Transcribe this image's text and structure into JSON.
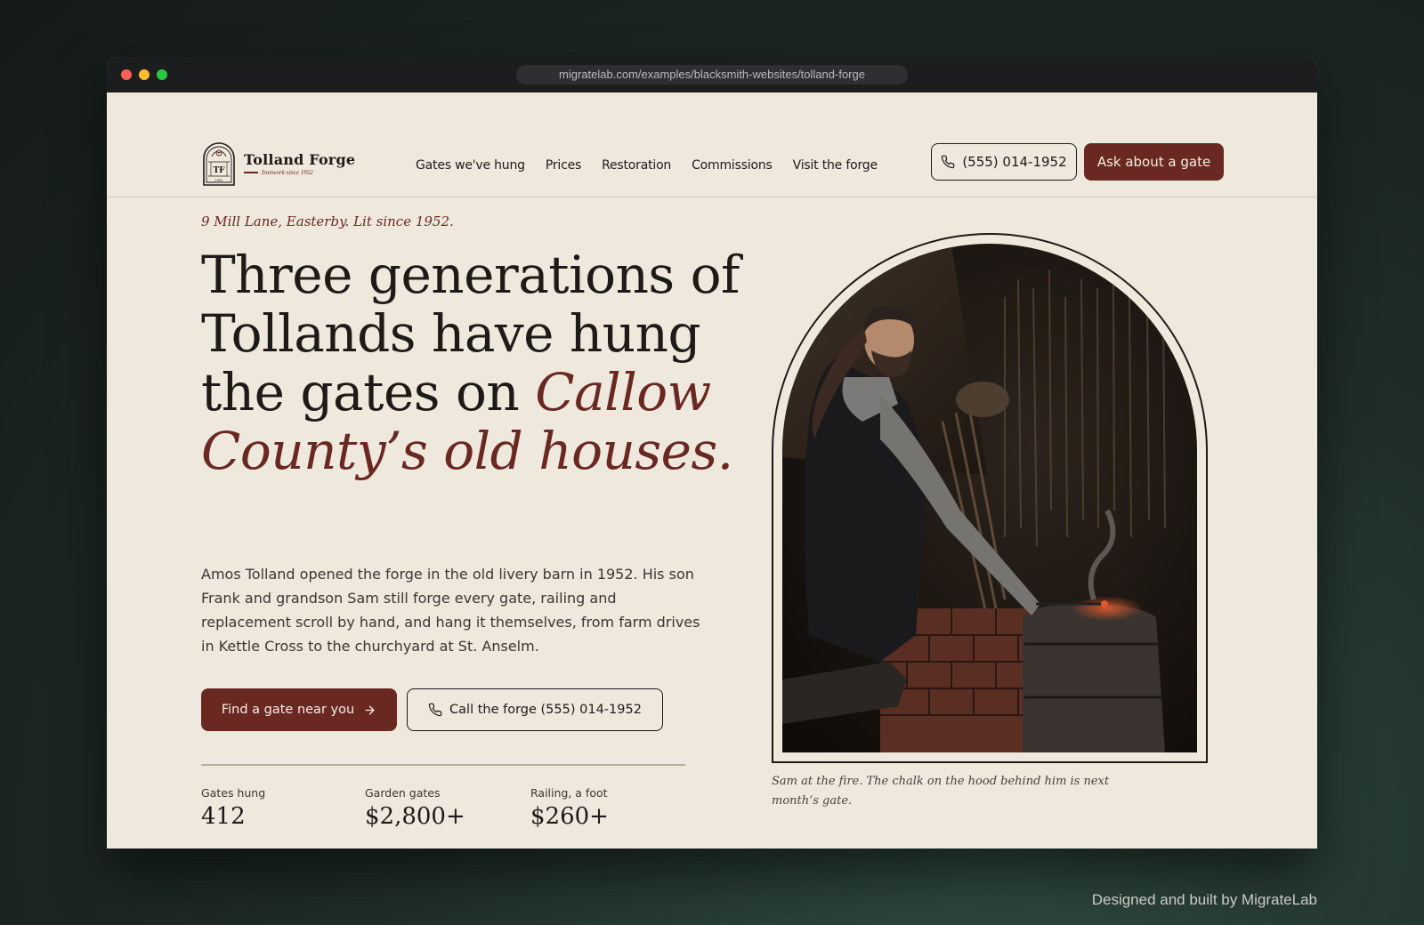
{
  "browser": {
    "url": "migratelab.com/examples/blacksmith-websites/tolland-forge"
  },
  "brand": {
    "name": "Tolland Forge",
    "tagline": "Ironwork since 1952",
    "monogram": "TF",
    "year": "1952"
  },
  "nav": {
    "links": [
      "Gates we've hung",
      "Prices",
      "Restoration",
      "Commissions",
      "Visit the forge"
    ],
    "phone_label": "(555) 014-1952",
    "cta_label": "Ask about a gate"
  },
  "hero": {
    "eyebrow": "9 Mill Lane, Easterby. Lit since 1952.",
    "headline_plain": "Three generations of Tollands have hung the gates on",
    "headline_accent": "Callow County’s old houses.",
    "lede": "Amos Tolland opened the forge in the old livery barn in 1952. His son Frank and grandson Sam still forge every gate, railing and replacement scroll by hand, and hang it themselves, from farm drives in Kettle Cross to the churchyard at St. Anselm.",
    "primary_cta": "Find a gate near you",
    "secondary_cta": "Call the forge (555) 014-1952"
  },
  "stats": [
    {
      "label": "Gates hung",
      "value": "412"
    },
    {
      "label": "Garden gates",
      "value": "$2,800+"
    },
    {
      "label": "Railing, a foot",
      "value": "$260+"
    }
  ],
  "photo": {
    "caption": "Sam at the fire. The chalk on the hood behind him is next month’s gate."
  },
  "footer": {
    "credit": "Designed and built by MigrateLab"
  },
  "colors": {
    "accent": "#6a2822",
    "background": "#efe8dd",
    "ink": "#1e1a17"
  },
  "icons": [
    "phone-icon",
    "arrow-right-icon",
    "logo-emblem-icon"
  ]
}
